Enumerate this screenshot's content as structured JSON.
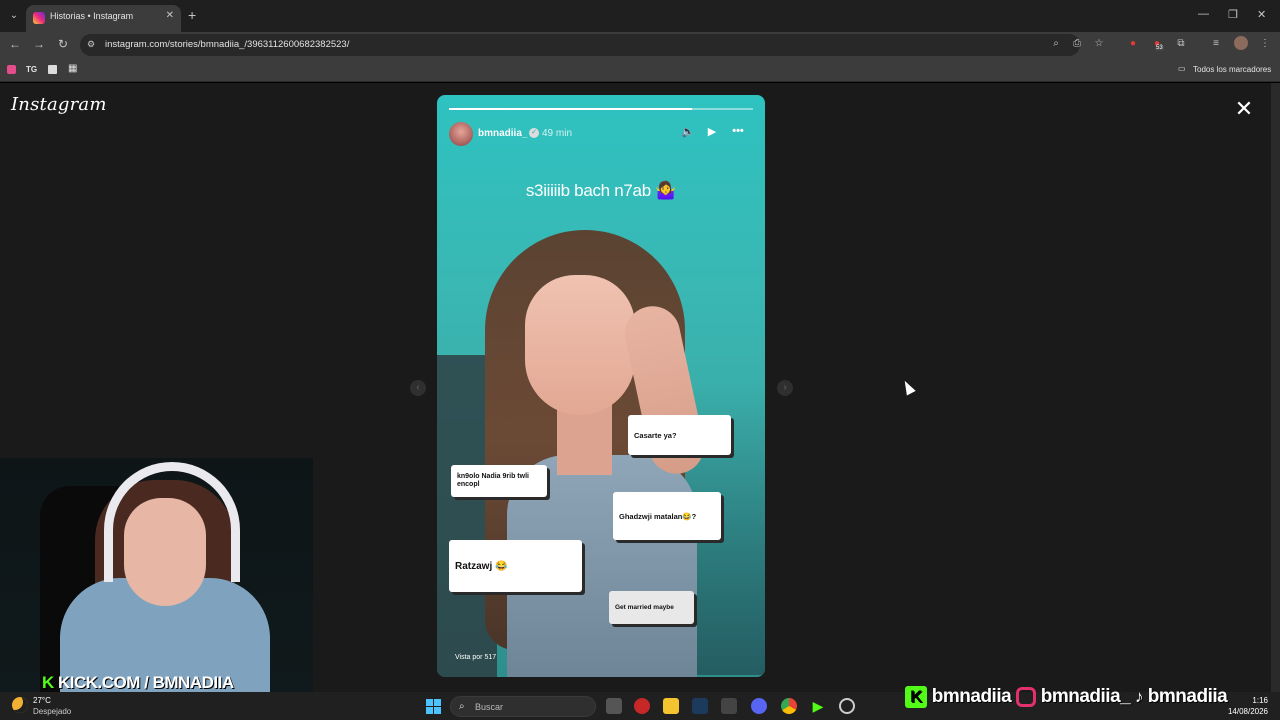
{
  "browser": {
    "tab_title": "Historias • Instagram",
    "url": "instagram.com/stories/bmnadiia_/3963112600682382523/",
    "bookmark_tg": "TG",
    "all_bookmarks": "Todos los marcadores",
    "extension_badge": "53"
  },
  "page": {
    "logo": "Instagram",
    "story": {
      "username": "bmnadiia_",
      "time_ago": "49 min",
      "caption": "s3iiiiib bach n7ab 🤷‍♀️",
      "progress": 0.8,
      "viewed_by": "Vista por 517",
      "stickers": [
        "Casarte ya?",
        "kn9olo Nadia 9rib twli encopl",
        "Ghadzwji matalan😂?",
        "Ratzawj 😂",
        "Get married maybe"
      ]
    }
  },
  "stream": {
    "kick_overlay": "KICK.COM / BMNADIIA",
    "socials": [
      "bmnadiia",
      "bmnadiia_",
      "bmnadiia"
    ]
  },
  "taskbar": {
    "temperature": "27°C",
    "weather": "Despejado",
    "search_placeholder": "Buscar",
    "time": "1:16",
    "date": "14/08/2026"
  }
}
